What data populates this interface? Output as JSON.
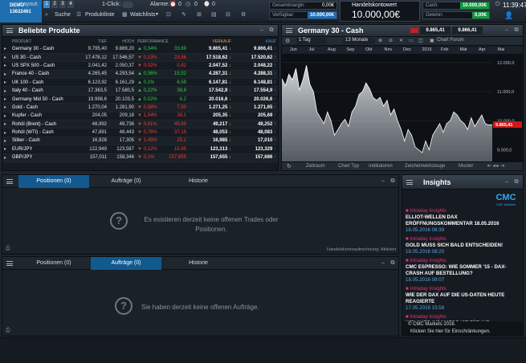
{
  "topbar": {
    "demo_label": "DEMO",
    "account_id": "13632461",
    "layout_label": "Layout:",
    "layouts": [
      "1",
      "2",
      "3",
      "4"
    ],
    "search_label": "Suche",
    "productlist_label": "Produktliste",
    "oneclick_label": "1-Click:",
    "watchlists_label": "Watchlists",
    "alarms_label": "Alarme:",
    "alarm_counts": [
      "0",
      "0",
      "0"
    ],
    "margin_label": "Gesamtmargin:",
    "margin_value": "0,00€",
    "available_label": "Verfügbar:",
    "available_value": "10.000,00€",
    "account_title": "Handelskontowert",
    "account_value": "10.000,00€",
    "cash_label": "Cash:",
    "cash_value": "10.000,00€",
    "gain_label": "Gewinn:",
    "gain_value": "0,00€",
    "time": "11:39:47"
  },
  "products": {
    "title": "Beliebte Produkte",
    "headers": {
      "product": "PRODUKT",
      "low": "TIEF",
      "high": "HOCH",
      "performance": "PERFORMANCE",
      "sell": "VERKAUF",
      "buy": "KAUF"
    },
    "rows": [
      {
        "name": "Germany 30 - Cash",
        "low": "9.795,40",
        "high": "9.889,20",
        "pct": "0,34%",
        "dir": "up",
        "pts": "33,69",
        "sell": "9.865,41",
        "buy": "9.866,41"
      },
      {
        "name": "US 30 - Cash",
        "low": "17.478,12",
        "high": "17.546,57",
        "pct": "0,13%",
        "dir": "down",
        "pts": "23,56",
        "sell": "17.518,62",
        "buy": "17.520,62"
      },
      {
        "name": "US SPX 500 - Cash",
        "low": "2.041,42",
        "high": "2.050,37",
        "pct": "0,02%",
        "dir": "down",
        "pts": "0,42",
        "sell": "2.047,52",
        "buy": "2.048,22"
      },
      {
        "name": "France 40 - Cash",
        "low": "4.265,45",
        "high": "4.293,54",
        "pct": "0,36%",
        "dir": "up",
        "pts": "15,52",
        "sell": "4.287,31",
        "buy": "4.288,31"
      },
      {
        "name": "UK 100 - Cash",
        "low": "6.123,92",
        "high": "6.161,29",
        "pct": "0,1%",
        "dir": "up",
        "pts": "6,59",
        "sell": "6.147,81",
        "buy": "6.148,81"
      },
      {
        "name": "Italy 40 - Cash",
        "low": "17.363,5",
        "high": "17.580,5",
        "pct": "0,22%",
        "dir": "up",
        "pts": "38,8",
        "sell": "17.542,9",
        "buy": "17.554,9"
      },
      {
        "name": "Germany Mid 50 - Cash",
        "low": "19.998,6",
        "high": "20.103,5",
        "pct": "0,02%",
        "dir": "up",
        "pts": "4,2",
        "sell": "20.016,6",
        "buy": "20.026,6"
      },
      {
        "name": "Gold - Cash",
        "low": "1.270,04",
        "high": "1.281,90",
        "pct": "0,58%",
        "dir": "down",
        "pts": "7,50",
        "sell": "1.271,25",
        "buy": "1.271,65"
      },
      {
        "name": "Kupfer - Cash",
        "low": "204,05",
        "high": "209,18",
        "pct": "1,34%",
        "dir": "down",
        "pts": "28,1",
        "sell": "205,35",
        "buy": "205,69"
      },
      {
        "name": "Rohöl (Brent) - Cash",
        "low": "48,992",
        "high": "49,736",
        "pct": "0,91%",
        "dir": "down",
        "pts": "45,65",
        "sell": "49,217",
        "buy": "49,252"
      },
      {
        "name": "Rohöl (WTI) - Cash",
        "low": "47,891",
        "high": "48,443",
        "pct": "0,76%",
        "dir": "down",
        "pts": "37,15",
        "sell": "48,053",
        "buy": "48,083"
      },
      {
        "name": "Silber - Cash",
        "low": "16,928",
        "high": "17,305",
        "pct": "1,45%",
        "dir": "down",
        "pts": "25,1",
        "sell": "16,985",
        "buy": "17,010"
      },
      {
        "name": "EUR/JPY",
        "low": "122,949",
        "high": "123,587",
        "pct": "0,12%",
        "dir": "down",
        "pts": "15,85",
        "sell": "123,313",
        "buy": "123,329"
      },
      {
        "name": "GBP/JPY",
        "low": "157,011",
        "high": "158,346",
        "pct": "0,1%",
        "dir": "down",
        "pts": "157,655",
        "sell": "157,655",
        "buy": "157,686"
      }
    ]
  },
  "chart": {
    "title": "Germany 30 - Cash",
    "sell": "9.865,41",
    "buy": "9.866,41",
    "interval": "1 Tag",
    "range": "13 Monate",
    "chart_forum": "Chart Forum",
    "months": [
      "Jun",
      "Jul",
      "Aug",
      "Sep",
      "Okt",
      "Nov",
      "Dez",
      "2016",
      "Feb",
      "Mär",
      "Apr",
      "Mai"
    ],
    "yticks": [
      "12.000,0",
      "11.000,0",
      "10.000,0",
      "9.000,0"
    ],
    "last_label": "9.865,41",
    "footer": [
      "Zeitraum",
      "Chart Typ",
      "Indikatoren",
      "Zeichenwerkzeuge",
      "Muster"
    ]
  },
  "chart_data": {
    "type": "line",
    "title": "Germany 30 - Cash",
    "x_labels": [
      "Jun",
      "Jul",
      "Aug",
      "Sep",
      "Okt",
      "Nov",
      "Dez",
      "2016",
      "Feb",
      "Mär",
      "Apr",
      "Mai"
    ],
    "ylim": [
      8600,
      12300
    ],
    "series": [
      {
        "values": [
          11450,
          11200,
          11600,
          11400,
          11800,
          11050,
          11400,
          11900,
          11250,
          11000,
          10300,
          10100,
          9900,
          10300,
          10000,
          9500,
          9700,
          9900,
          10050,
          9800,
          10300,
          10500,
          10900,
          11000,
          11300,
          11100,
          10800,
          10700,
          10800,
          10500,
          10700,
          10200,
          10400,
          10000,
          9700,
          9300,
          9700,
          9500,
          9100,
          9000,
          8900,
          9300,
          9000,
          9500,
          9700,
          9900,
          9600,
          9900,
          10000,
          10300,
          10200,
          10000,
          9900,
          9700,
          10100,
          9800,
          10000,
          10200,
          9900,
          9850,
          9865
        ]
      }
    ]
  },
  "positions": {
    "tabs": [
      "Positionen (0)",
      "Aufträge (0)",
      "Historie"
    ],
    "empty_msg": "Es existieren derzeit keine offenen Trades oder Positionen.",
    "footer": "Handelskontoaufrechnung: Aktiviert"
  },
  "orders": {
    "tabs": [
      "Positionen (0)",
      "Aufträge (0)",
      "Historie"
    ],
    "empty_msg": "Sie haben derzeit keine offenen Aufträge."
  },
  "insights": {
    "title": "Insights",
    "logo": "CMC",
    "logo_sub": "CMC Markets",
    "items": [
      {
        "cat": "Intraday Insights",
        "title": "ELLIOT-WELLEN DAX ERÖFFNUNGSKOMMENTAR 18.05.2016",
        "date": "18.05.2016 08:39"
      },
      {
        "cat": "Intraday Insights",
        "title": "GOLD MUSS SICH BALD ENTSCHEIDEN!",
        "date": "18.05.2016 08:20"
      },
      {
        "cat": "Intraday Insights",
        "title": "CMC ESPRESSO: WIE SOMMER '15 - DAX-CRASH AUF BESTELLUNG?",
        "date": "18.05.2016 08:07"
      },
      {
        "cat": "Intraday Insights",
        "title": "WIE DER DAX AUF DIE US-DATEN HEUTE REAGIERTE",
        "date": "17.05.2016 15:58"
      },
      {
        "cat": "Intraday Insights",
        "title": "WELCHER INDIKATOR IST FÜR IHR"
      }
    ],
    "copyright": "© CMC Markets 2016.",
    "restrictions": "Klicken Sie hier für Einschränkungen."
  }
}
